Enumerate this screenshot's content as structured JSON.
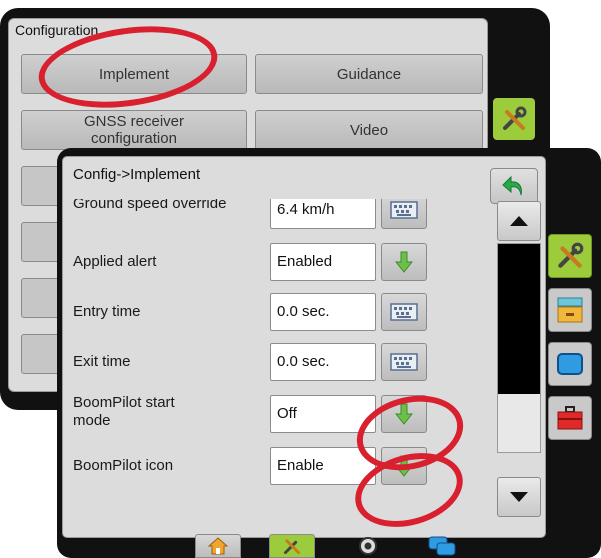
{
  "back_window": {
    "title": "Configuration",
    "buttons": {
      "implement": "Implement",
      "guidance": "Guidance",
      "gnss": "GNSS receiver configuration",
      "video": "Video"
    }
  },
  "front_window": {
    "title": "Config->Implement",
    "rows": [
      {
        "label": "Ground speed override",
        "value": "6.4 km/h",
        "control": "keyboard-icon"
      },
      {
        "label": "Applied alert",
        "value": "Enabled",
        "control": "green-down-arrow-icon"
      },
      {
        "label": "Entry time",
        "value": "0.0 sec.",
        "control": "keyboard-icon"
      },
      {
        "label": "Exit time",
        "value": "0.0 sec.",
        "control": "keyboard-icon"
      },
      {
        "label": "BoomPilot start mode",
        "value": "Off",
        "control": "green-down-arrow-icon"
      },
      {
        "label": "BoomPilot icon",
        "value": "Enable",
        "control": "green-down-arrow-icon"
      }
    ],
    "side_rail": [
      "tools-icon",
      "data-drawer-icon",
      "blue-screen-icon",
      "red-toolbox-icon"
    ],
    "bottom_bar": [
      "home-icon",
      "tools-icon",
      "target-icon",
      "layers-icon"
    ]
  },
  "colors": {
    "annotation_red": "#d8202e",
    "active_green": "#9ccb3b",
    "arrow_green": "#6cc04a",
    "window_black": "#111111"
  }
}
